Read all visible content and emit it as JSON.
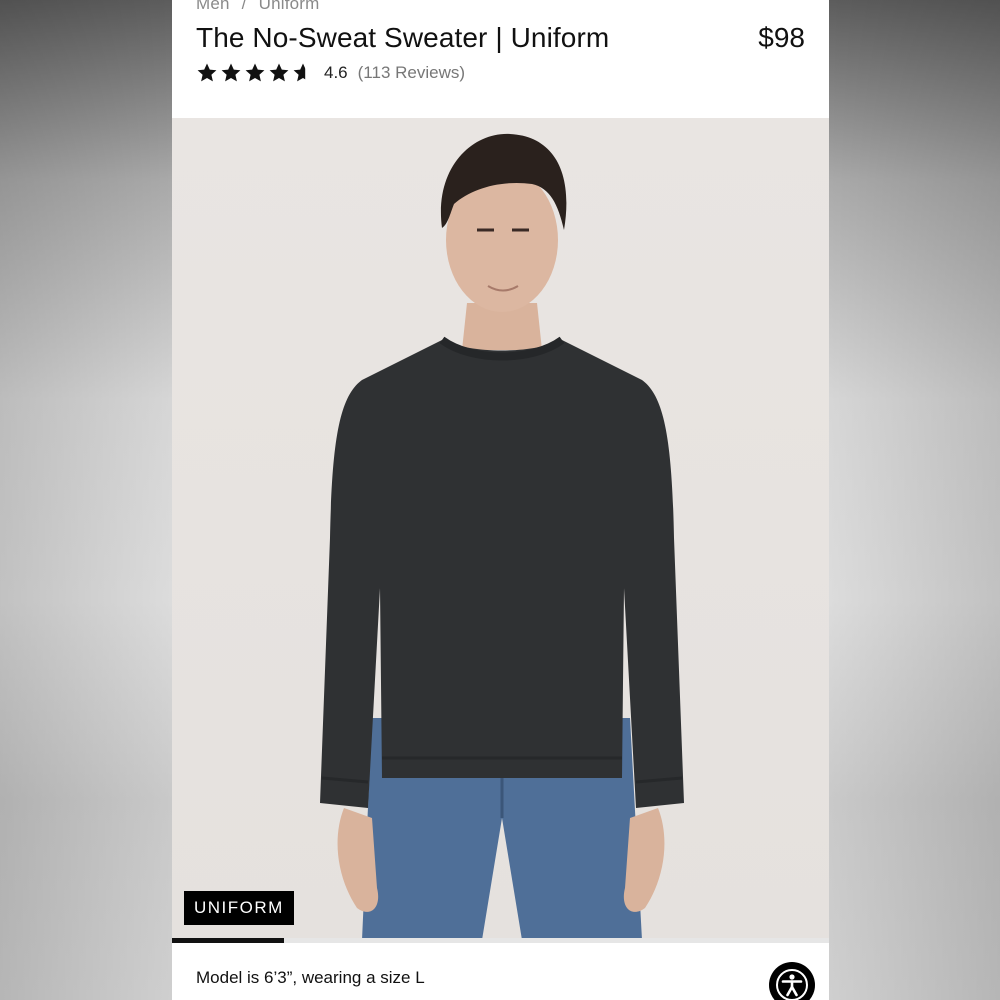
{
  "breadcrumb": {
    "items": [
      "Men",
      "Uniform"
    ],
    "separator": "/"
  },
  "product": {
    "title": "The No-Sweat Sweater | Uniform",
    "price": "$98",
    "rating_value": "4.6",
    "rating_numeric": 4.6,
    "rating_max": 5,
    "reviews_text": "(113 Reviews)"
  },
  "gallery": {
    "badge": "UNIFORM",
    "progress_fraction": 0.17,
    "caption": "Model is 6’3”, wearing a size L"
  },
  "icons": {
    "star": "star-icon",
    "accessibility": "accessibility-icon"
  },
  "colors": {
    "text": "#111111",
    "muted": "#8a8a8a",
    "badge_bg": "#000000",
    "sweater": "#2f3133",
    "jeans": "#4f6f98"
  }
}
